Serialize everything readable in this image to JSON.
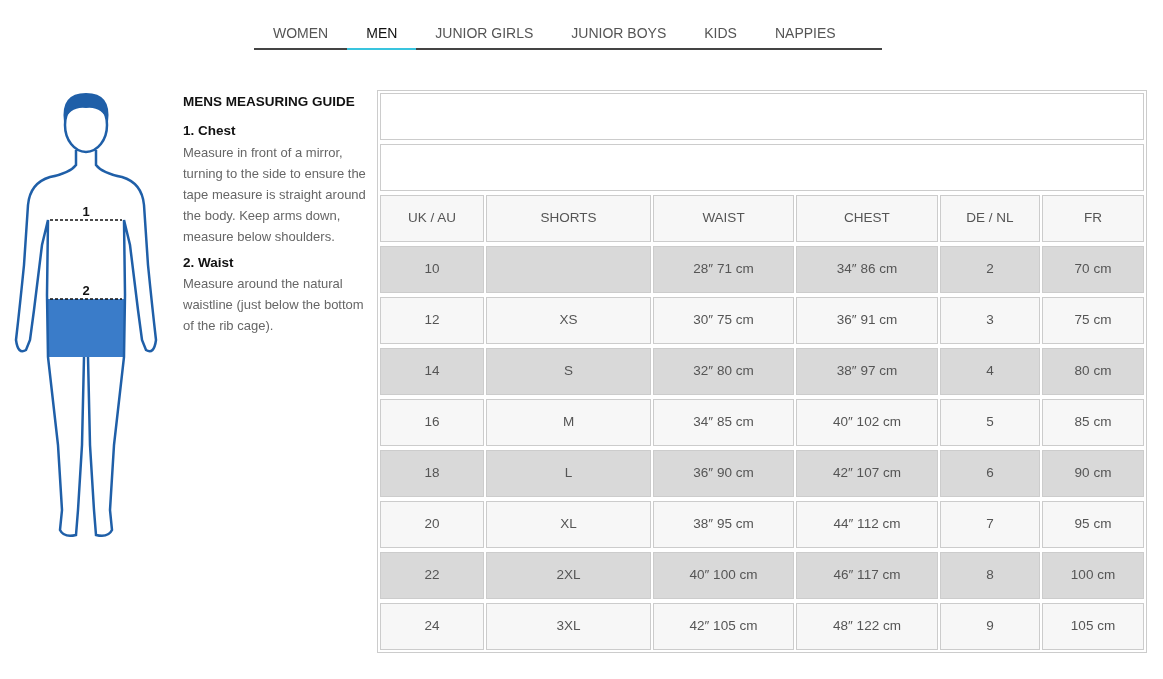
{
  "tabs": [
    {
      "label": "WOMEN",
      "selected": false
    },
    {
      "label": "MEN",
      "selected": true
    },
    {
      "label": "JUNIOR GIRLS",
      "selected": false
    },
    {
      "label": "JUNIOR BOYS",
      "selected": false
    },
    {
      "label": "KIDS",
      "selected": false
    },
    {
      "label": "NAPPIES",
      "selected": false
    }
  ],
  "figure": {
    "markers": [
      "1",
      "2"
    ]
  },
  "guide": {
    "title": "MENS MEASURING GUIDE",
    "sections": [
      {
        "heading": "1. Chest",
        "text": "Measure in front of a mirror, turning to the side to ensure the tape measure is straight around the body. Keep arms down, measure below shoulders."
      },
      {
        "heading": "2. Waist",
        "text": "Measure around the natural waistline (just below the bottom of the rib cage)."
      }
    ]
  },
  "table": {
    "columns": [
      "UK / AU",
      "SHORTS",
      "WAIST",
      "CHEST",
      "DE / NL",
      "FR"
    ],
    "rows": [
      {
        "uk_au": "10",
        "waist": "28″ 71 cm",
        "chest": "34″ 86 cm",
        "de_nl": "2",
        "fr": "70 cm"
      },
      {
        "uk_au": "12",
        "shorts": "XS",
        "waist": "30″ 75 cm",
        "chest": "36″ 91 cm",
        "de_nl": "3",
        "fr": "75 cm"
      },
      {
        "uk_au": "14",
        "shorts": "S",
        "waist": "32″ 80 cm",
        "chest": "38″ 97 cm",
        "de_nl": "4",
        "fr": "80 cm"
      },
      {
        "uk_au": "16",
        "shorts": "M",
        "waist": "34″ 85 cm",
        "chest": "40″ 102 cm",
        "de_nl": "5",
        "fr": "85 cm"
      },
      {
        "uk_au": "18",
        "shorts": "L",
        "waist": "36″ 90 cm",
        "chest": "42″ 107 cm",
        "de_nl": "6",
        "fr": "90 cm"
      },
      {
        "uk_au": "20",
        "shorts": "XL",
        "waist": "38″ 95 cm",
        "chest": "44″ 112 cm",
        "de_nl": "7",
        "fr": "95 cm"
      },
      {
        "uk_au": "22",
        "shorts": "2XL",
        "waist": "40″ 100 cm",
        "chest": "46″ 117 cm",
        "de_nl": "8",
        "fr": "100 cm"
      },
      {
        "uk_au": "24",
        "shorts": "3XL",
        "waist": "42″ 105 cm",
        "chest": "48″ 122 cm",
        "de_nl": "9",
        "fr": "105 cm"
      }
    ]
  }
}
